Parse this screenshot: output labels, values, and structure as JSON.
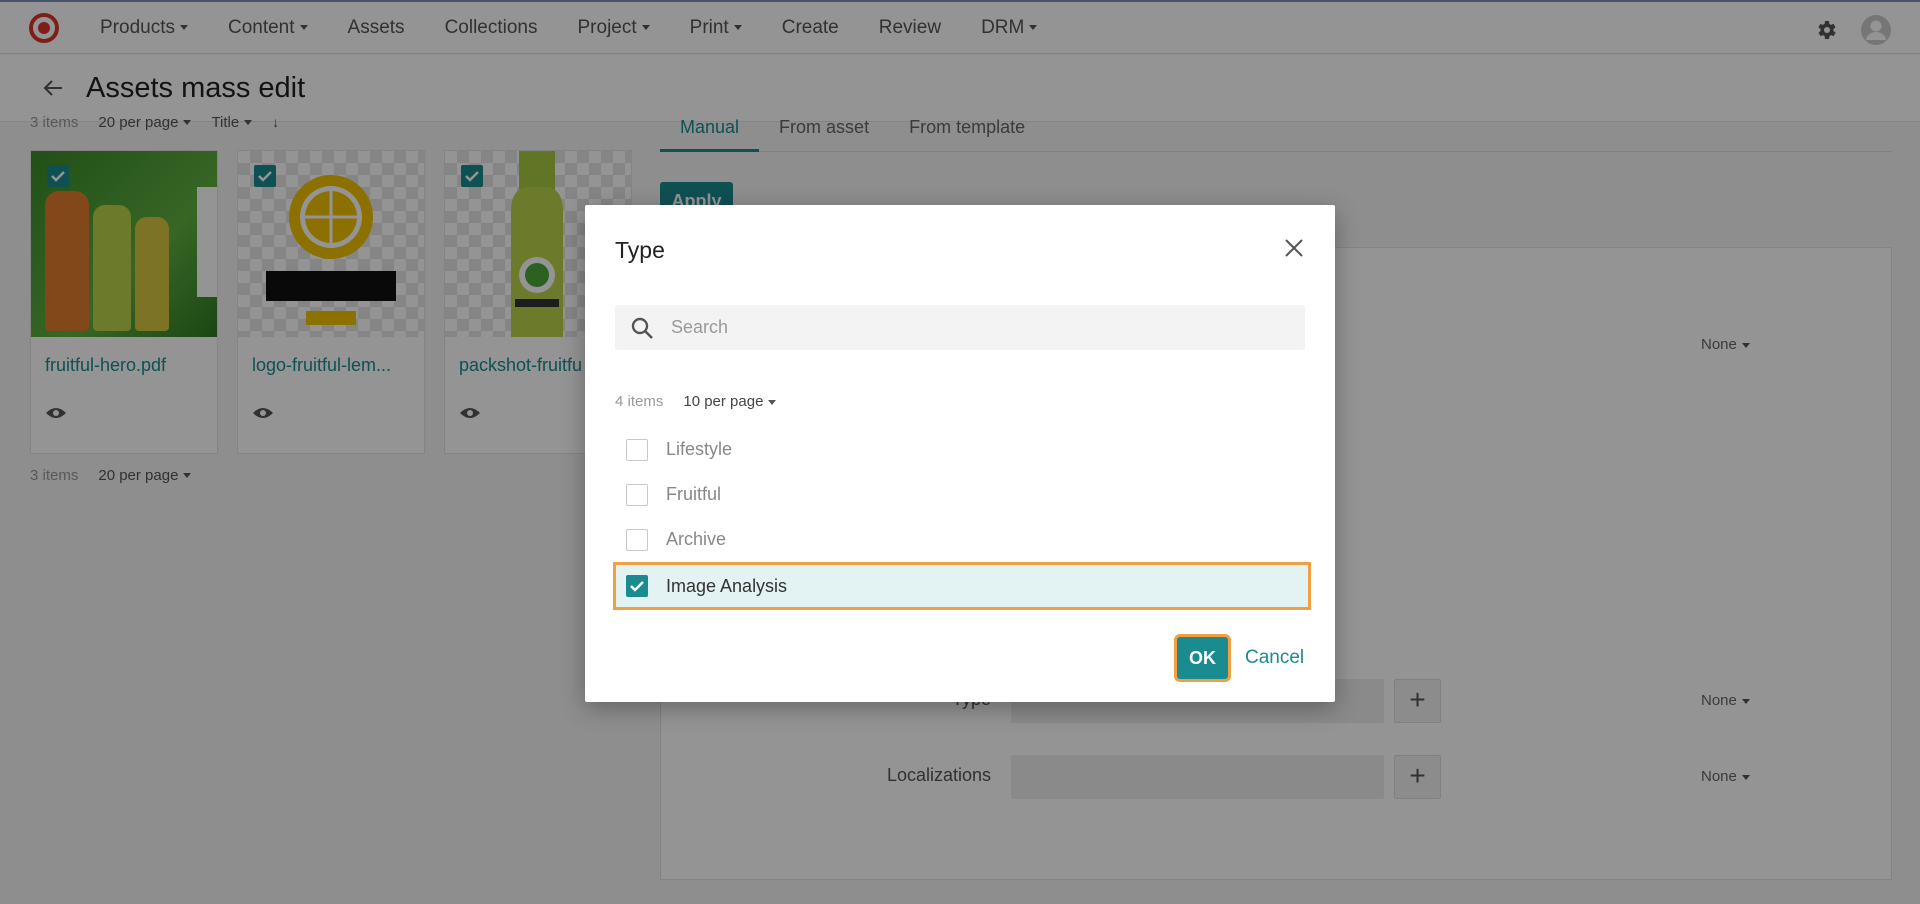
{
  "topnav": {
    "items": [
      {
        "label": "Products",
        "dropdown": true
      },
      {
        "label": "Content",
        "dropdown": true
      },
      {
        "label": "Assets",
        "dropdown": false
      },
      {
        "label": "Collections",
        "dropdown": false
      },
      {
        "label": "Project",
        "dropdown": true
      },
      {
        "label": "Print",
        "dropdown": true
      },
      {
        "label": "Create",
        "dropdown": false
      },
      {
        "label": "Review",
        "dropdown": false
      },
      {
        "label": "DRM",
        "dropdown": true
      }
    ]
  },
  "header": {
    "title": "Assets mass edit"
  },
  "left": {
    "top_pager": {
      "count": "3 items",
      "per_page": "20 per page",
      "sort": "Title"
    },
    "cards": [
      {
        "name": "fruitful-hero.pdf"
      },
      {
        "name": "logo-fruitful-lem..."
      },
      {
        "name": "packshot-fruitfu"
      }
    ],
    "bottom_pager": {
      "count": "3 items",
      "per_page": "20 per page"
    }
  },
  "right": {
    "tabs": [
      "Manual",
      "From asset",
      "From template"
    ],
    "apply_label": "Apply",
    "type_label": "Type",
    "localizations_label": "Localizations",
    "none_label": "None"
  },
  "modal": {
    "title": "Type",
    "search_placeholder": "Search",
    "count": "4 items",
    "per_page": "10 per page",
    "options": [
      {
        "label": "Lifestyle",
        "checked": false
      },
      {
        "label": "Fruitful",
        "checked": false
      },
      {
        "label": "Archive",
        "checked": false
      },
      {
        "label": "Image Analysis",
        "checked": true
      }
    ],
    "ok_label": "OK",
    "cancel_label": "Cancel"
  },
  "colors": {
    "accent": "#1a8b8f",
    "focus": "#f0a040"
  }
}
